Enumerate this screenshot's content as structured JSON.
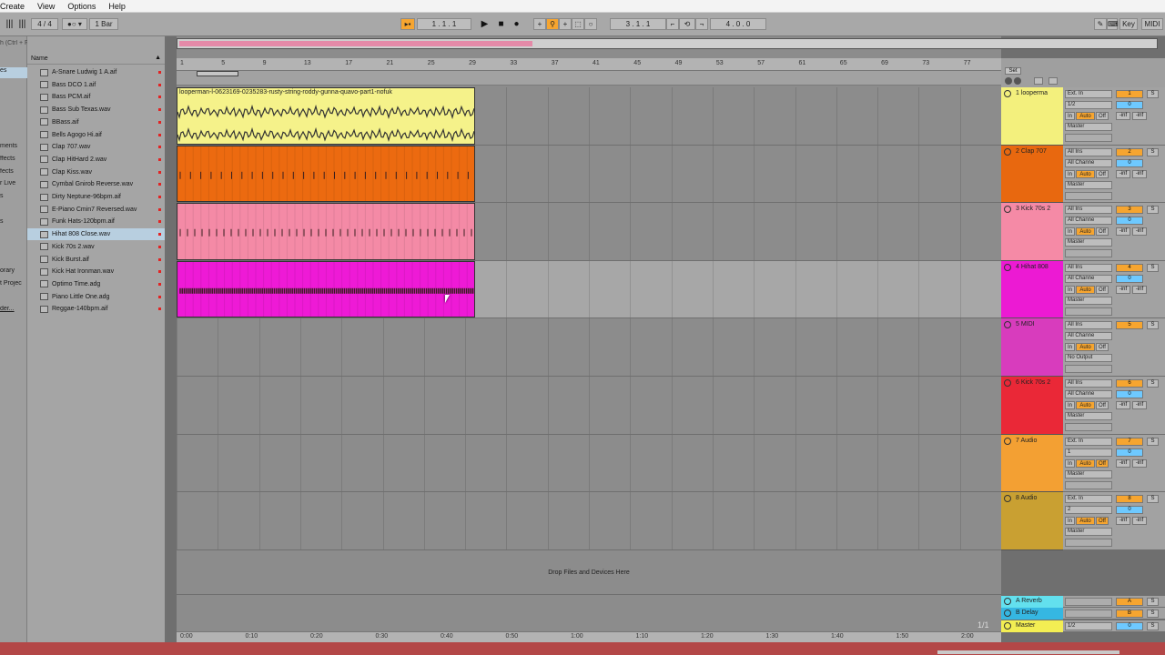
{
  "menu": [
    "Create",
    "View",
    "Options",
    "Help"
  ],
  "control_bar": {
    "time_signature": "4 / 4",
    "quantize": "1 Bar",
    "position": "1 . 1 . 1",
    "loop_start": "3 . 1 . 1",
    "loop_length": "4 . 0 . 0",
    "key_label": "Key",
    "midi_label": "MIDI"
  },
  "browser": {
    "search_placeholder": "h (Ctrl + F)",
    "column_header": "Name",
    "categories": [
      "es",
      "ments",
      "ffects",
      "fects",
      "r Live",
      "s",
      "s",
      "orary",
      "t Projec",
      "der..."
    ],
    "files": [
      "A-Snare Ludwig 1 A.aif",
      "Bass DCO 1.aif",
      "Bass PCM.aif",
      "Bass Sub Texas.wav",
      "BBass.aif",
      "Bells Agogo Hi.aif",
      "Clap 707.wav",
      "Clap HitHard 2.wav",
      "Clap Kiss.wav",
      "Cymbal Gnirob Reverse.wav",
      "Dirty Neptune-96bpm.aif",
      "E-Piano Cmin7 Reversed.wav",
      "Funk Hats-120bpm.aif",
      "Hihat 808 Close.wav",
      "Kick 70s 2.wav",
      "Kick Burst.aif",
      "Kick Hat Ironman.wav",
      "Optimo Time.adg",
      "Piano Little One.adg",
      "Reggae-140bpm.aif"
    ],
    "selected_index": 13
  },
  "ruler": {
    "bars": [
      "1",
      "5",
      "9",
      "13",
      "17",
      "21",
      "25",
      "29",
      "33",
      "37",
      "41",
      "45",
      "49",
      "53",
      "57",
      "61",
      "65",
      "69",
      "73",
      "77"
    ],
    "times": [
      "0:00",
      "0:10",
      "0:20",
      "0:30",
      "0:40",
      "0:50",
      "1:00",
      "1:10",
      "1:20",
      "1:30",
      "1:40",
      "1:50",
      "2:00"
    ]
  },
  "set_label": "Set",
  "drop_text": "Drop Files and Devices Here",
  "page_counter": "1/1",
  "clip_title": "looperman-l-0623169-0235283-rusty-string-roddy-gunna-quavo-part1-nofuk",
  "tracks": [
    {
      "name": "1 looperma",
      "color": "#f3f07d",
      "clip_color": "#f5f28a",
      "input": "Ext. In",
      "channel": "1/2",
      "monitor": [
        "In",
        "Auto",
        "Off"
      ],
      "output": "Master",
      "number": "1",
      "vol": "0",
      "pan": [
        "-inf",
        "-inf"
      ]
    },
    {
      "name": "2 Clap 707",
      "color": "#e8680f",
      "clip_color": "#ec6a10",
      "input": "All Ins",
      "channel": "All Channe",
      "monitor": [
        "In",
        "Auto",
        "Off"
      ],
      "output": "Master",
      "number": "2",
      "vol": "0",
      "pan": [
        "-inf",
        "-inf"
      ]
    },
    {
      "name": "3 Kick 70s 2",
      "color": "#f58aa6",
      "clip_color": "#f48aa6",
      "input": "All Ins",
      "channel": "All Channe",
      "monitor": [
        "In",
        "Auto",
        "Off"
      ],
      "output": "Master",
      "number": "3",
      "vol": "0",
      "pan": [
        "-inf",
        "-inf"
      ]
    },
    {
      "name": "4 Hihat 808",
      "color": "#ec1ad3",
      "clip_color": "#ee1ad6",
      "input": "All Ins",
      "channel": "All Channe",
      "monitor": [
        "In",
        "Auto",
        "Off"
      ],
      "output": "Master",
      "number": "4",
      "vol": "0",
      "pan": [
        "-inf",
        "-inf"
      ]
    },
    {
      "name": "5 MIDI",
      "color": "#d83cbd",
      "input": "All Ins",
      "channel": "All Channe",
      "monitor": [
        "In",
        "Auto",
        "Off"
      ],
      "output": "No Output",
      "number": "5"
    },
    {
      "name": "6 Kick 70s 2",
      "color": "#ea2837",
      "input": "All Ins",
      "channel": "All Channe",
      "monitor": [
        "In",
        "Auto",
        "Off"
      ],
      "output": "Master",
      "number": "6",
      "vol": "0",
      "pan": [
        "-inf",
        "-inf"
      ]
    },
    {
      "name": "7 Audio",
      "color": "#f3a033",
      "input": "Ext. In",
      "channel": "1",
      "monitor": [
        "In",
        "Auto",
        "Off"
      ],
      "output": "Master",
      "number": "7",
      "vol": "0",
      "pan": [
        "-inf",
        "-inf"
      ]
    },
    {
      "name": "8 Audio",
      "color": "#c9a032",
      "input": "Ext. In",
      "channel": "2",
      "monitor": [
        "In",
        "Auto",
        "Off"
      ],
      "output": "Master",
      "number": "8",
      "vol": "0",
      "pan": [
        "-inf",
        "-inf"
      ]
    }
  ],
  "returns": [
    {
      "name": "A Reverb",
      "color": "#63e0ee",
      "letter": "A"
    },
    {
      "name": "B Delay",
      "color": "#35b7e2",
      "letter": "B"
    }
  ],
  "master": {
    "name": "Master",
    "color": "#f3ee53",
    "channel": "1/2",
    "vol": "0"
  }
}
